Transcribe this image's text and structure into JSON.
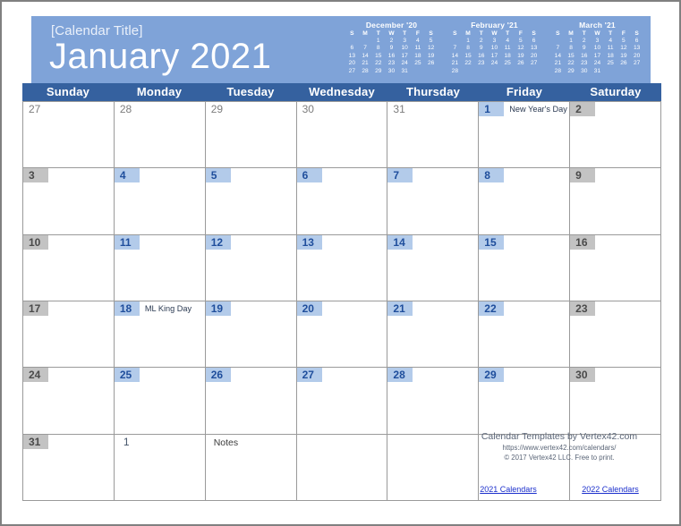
{
  "banner": {
    "calendar_title": "[Calendar Title]",
    "month_year": "January 2021",
    "bg_color": "#7fa3d8"
  },
  "mini_calendars": [
    {
      "title": "December '20",
      "dow": [
        "S",
        "M",
        "T",
        "W",
        "T",
        "F",
        "S"
      ],
      "weeks": [
        [
          "",
          "",
          "1",
          "2",
          "3",
          "4",
          "5"
        ],
        [
          "6",
          "7",
          "8",
          "9",
          "10",
          "11",
          "12"
        ],
        [
          "13",
          "14",
          "15",
          "16",
          "17",
          "18",
          "19"
        ],
        [
          "20",
          "21",
          "22",
          "23",
          "24",
          "25",
          "26"
        ],
        [
          "27",
          "28",
          "29",
          "30",
          "31",
          "",
          ""
        ]
      ]
    },
    {
      "title": "February '21",
      "dow": [
        "S",
        "M",
        "T",
        "W",
        "T",
        "F",
        "S"
      ],
      "weeks": [
        [
          "",
          "1",
          "2",
          "3",
          "4",
          "5",
          "6"
        ],
        [
          "7",
          "8",
          "9",
          "10",
          "11",
          "12",
          "13"
        ],
        [
          "14",
          "15",
          "16",
          "17",
          "18",
          "19",
          "20"
        ],
        [
          "21",
          "22",
          "23",
          "24",
          "25",
          "26",
          "27"
        ],
        [
          "28",
          "",
          "",
          "",
          "",
          "",
          ""
        ]
      ]
    },
    {
      "title": "March '21",
      "dow": [
        "S",
        "M",
        "T",
        "W",
        "T",
        "F",
        "S"
      ],
      "weeks": [
        [
          "",
          "1",
          "2",
          "3",
          "4",
          "5",
          "6"
        ],
        [
          "7",
          "8",
          "9",
          "10",
          "11",
          "12",
          "13"
        ],
        [
          "14",
          "15",
          "16",
          "17",
          "18",
          "19",
          "20"
        ],
        [
          "21",
          "22",
          "23",
          "24",
          "25",
          "26",
          "27"
        ],
        [
          "28",
          "29",
          "30",
          "31",
          "",
          "",
          ""
        ]
      ]
    }
  ],
  "weekday_headers": [
    "Sunday",
    "Monday",
    "Tuesday",
    "Wednesday",
    "Thursday",
    "Friday",
    "Saturday"
  ],
  "colors": {
    "header_row": "#35619f",
    "weekday_badge": "#b3cbea",
    "weekend_badge": "#c3c3c3",
    "grid_line": "#9a9a9a",
    "link": "#1a2ecc"
  },
  "days": [
    {
      "num": "27",
      "style": "plain",
      "event": ""
    },
    {
      "num": "28",
      "style": "plain",
      "event": ""
    },
    {
      "num": "29",
      "style": "plain",
      "event": ""
    },
    {
      "num": "30",
      "style": "plain",
      "event": ""
    },
    {
      "num": "31",
      "style": "plain",
      "event": ""
    },
    {
      "num": "1",
      "style": "weekday",
      "event": "New Year's Day"
    },
    {
      "num": "2",
      "style": "weekend",
      "event": ""
    },
    {
      "num": "3",
      "style": "weekend",
      "event": ""
    },
    {
      "num": "4",
      "style": "weekday",
      "event": ""
    },
    {
      "num": "5",
      "style": "weekday",
      "event": ""
    },
    {
      "num": "6",
      "style": "weekday",
      "event": ""
    },
    {
      "num": "7",
      "style": "weekday",
      "event": ""
    },
    {
      "num": "8",
      "style": "weekday",
      "event": ""
    },
    {
      "num": "9",
      "style": "weekend",
      "event": ""
    },
    {
      "num": "10",
      "style": "weekend",
      "event": ""
    },
    {
      "num": "11",
      "style": "weekday",
      "event": ""
    },
    {
      "num": "12",
      "style": "weekday",
      "event": ""
    },
    {
      "num": "13",
      "style": "weekday",
      "event": ""
    },
    {
      "num": "14",
      "style": "weekday",
      "event": ""
    },
    {
      "num": "15",
      "style": "weekday",
      "event": ""
    },
    {
      "num": "16",
      "style": "weekend",
      "event": ""
    },
    {
      "num": "17",
      "style": "weekend",
      "event": ""
    },
    {
      "num": "18",
      "style": "weekday",
      "event": "ML King Day"
    },
    {
      "num": "19",
      "style": "weekday",
      "event": ""
    },
    {
      "num": "20",
      "style": "weekday",
      "event": ""
    },
    {
      "num": "21",
      "style": "weekday",
      "event": ""
    },
    {
      "num": "22",
      "style": "weekday",
      "event": ""
    },
    {
      "num": "23",
      "style": "weekend",
      "event": ""
    },
    {
      "num": "24",
      "style": "weekend",
      "event": ""
    },
    {
      "num": "25",
      "style": "weekday",
      "event": ""
    },
    {
      "num": "26",
      "style": "weekday",
      "event": ""
    },
    {
      "num": "27",
      "style": "weekday",
      "event": ""
    },
    {
      "num": "28",
      "style": "weekday",
      "event": ""
    },
    {
      "num": "29",
      "style": "weekday",
      "event": ""
    },
    {
      "num": "30",
      "style": "weekend",
      "event": ""
    },
    {
      "num": "31",
      "style": "weekend",
      "event": ""
    },
    {
      "num": "1",
      "style": "next",
      "event": ""
    },
    {
      "num": "",
      "style": "notes",
      "event": "Notes"
    },
    {
      "num": "",
      "style": "empty",
      "event": ""
    },
    {
      "num": "",
      "style": "empty",
      "event": ""
    },
    {
      "num": "",
      "style": "empty",
      "event": ""
    },
    {
      "num": "",
      "style": "empty",
      "event": ""
    }
  ],
  "footer": {
    "line1": "Calendar Templates by Vertex42.com",
    "line2": "https://www.vertex42.com/calendars/",
    "line3": "© 2017 Vertex42 LLC. Free to print.",
    "link1": "2021 Calendars",
    "link2": "2022 Calendars"
  }
}
